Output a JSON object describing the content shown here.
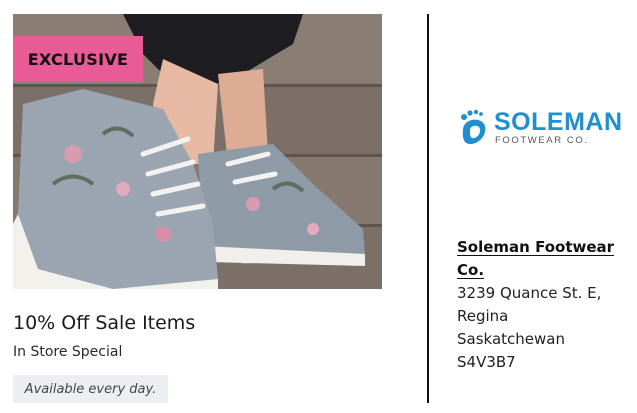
{
  "promo": {
    "badge": "EXCLUSIVE",
    "title": "10% Off Sale Items",
    "subtitle": "In Store Special",
    "availability": "Available every day."
  },
  "business": {
    "logo_word": "SOLEMAN",
    "logo_tagline": "FOOTWEAR CO.",
    "name": "Soleman Footwear Co.",
    "address_lines": [
      "3239 Quance St. E,",
      "Regina",
      "Saskatchewan",
      "S4V3B7"
    ]
  },
  "colors": {
    "badge": "#e85b95",
    "brand": "#1f8fcf",
    "chip": "#eceef1"
  }
}
